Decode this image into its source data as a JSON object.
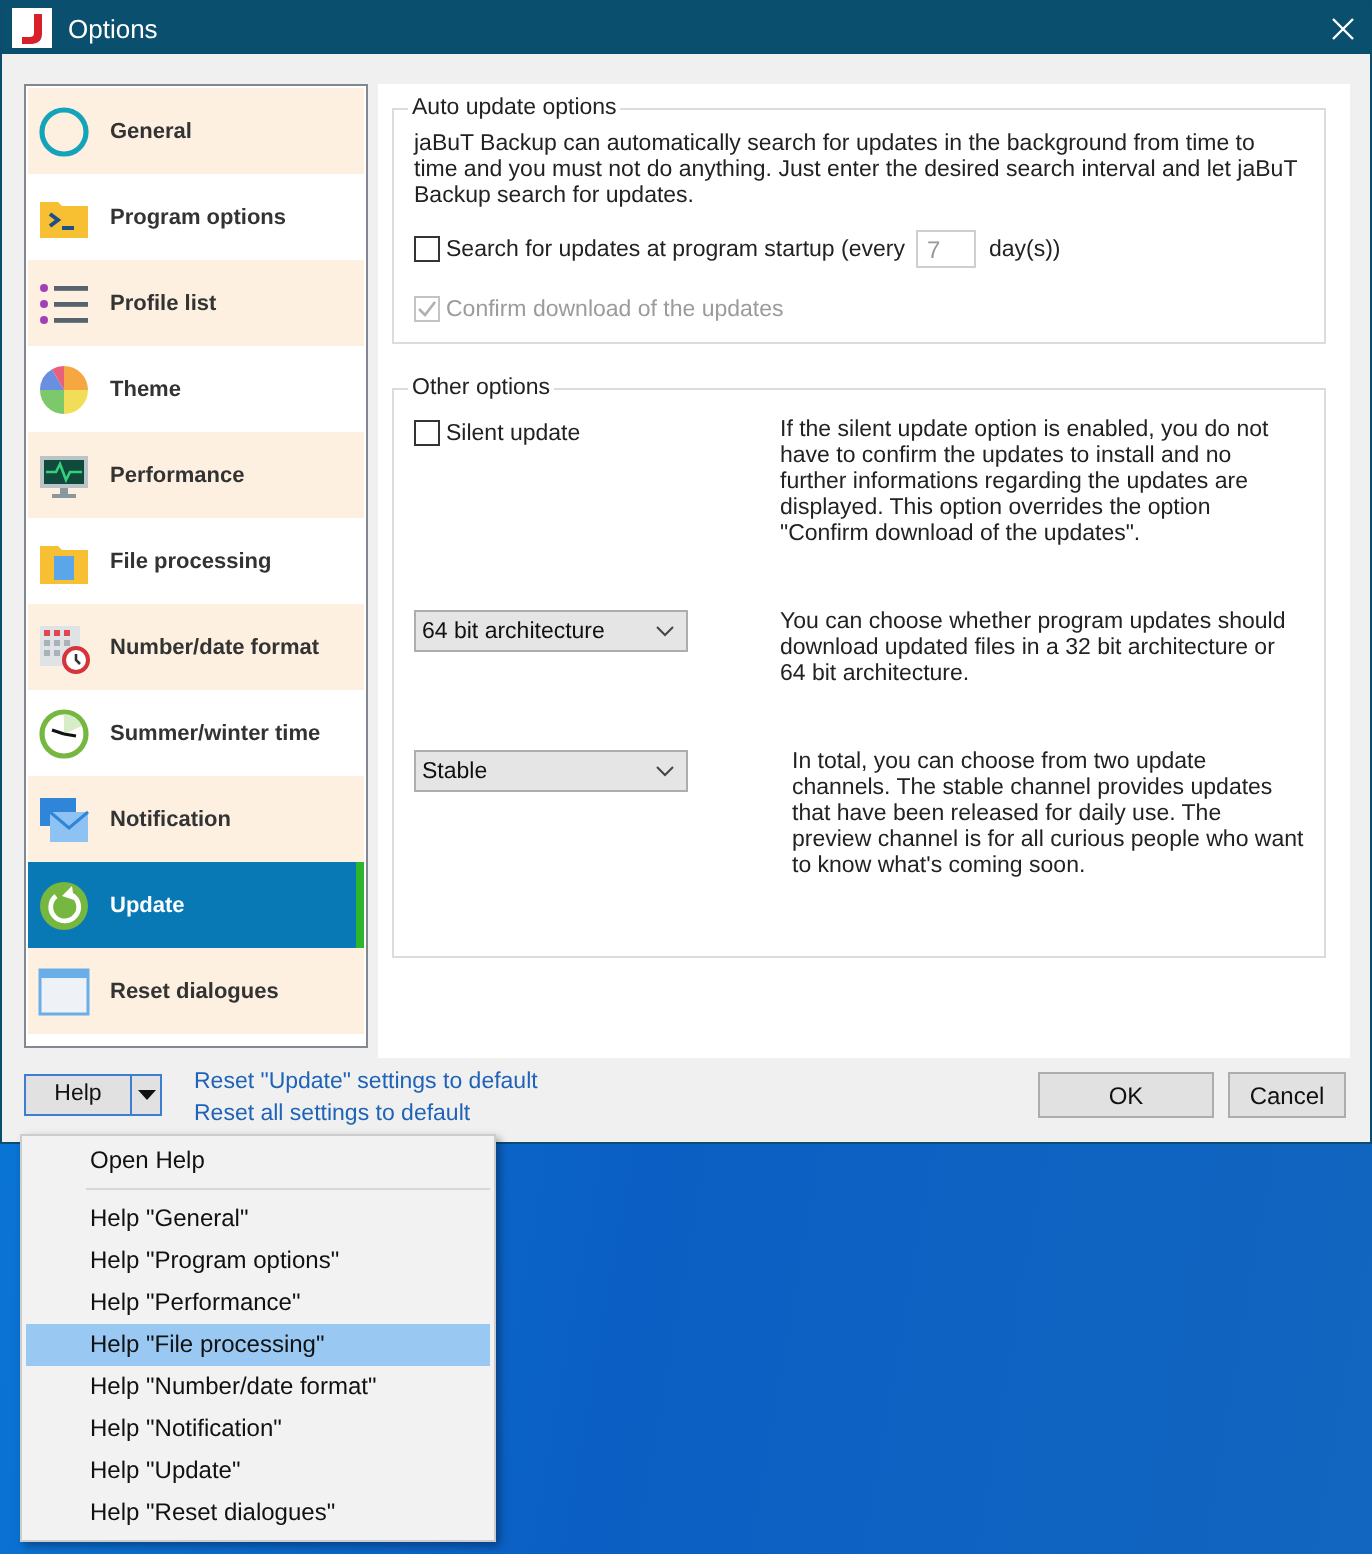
{
  "window": {
    "title": "Options"
  },
  "sidebar": {
    "items": [
      {
        "label": "General",
        "selected": false
      },
      {
        "label": "Program options",
        "selected": false
      },
      {
        "label": "Profile list",
        "selected": false
      },
      {
        "label": "Theme",
        "selected": false
      },
      {
        "label": "Performance",
        "selected": false
      },
      {
        "label": "File processing",
        "selected": false
      },
      {
        "label": "Number/date format",
        "selected": false
      },
      {
        "label": "Summer/winter time",
        "selected": false
      },
      {
        "label": "Notification",
        "selected": false
      },
      {
        "label": "Update",
        "selected": true
      },
      {
        "label": "Reset dialogues",
        "selected": false
      }
    ]
  },
  "auto_update": {
    "title": "Auto update options",
    "description": "jaBuT Backup can automatically search for updates in the background from time to time and you must not do anything. Just enter the desired search interval and let jaBuT Backup search for updates.",
    "startup_check": {
      "label": "Search for updates at program startup (every",
      "checked": false
    },
    "interval": {
      "value": "7",
      "disabled": true
    },
    "interval_unit": "day(s))",
    "confirm": {
      "label": "Confirm download of the updates",
      "checked": true,
      "disabled": true
    }
  },
  "other_options": {
    "title": "Other options",
    "silent": {
      "label": "Silent update",
      "checked": false
    },
    "silent_description": "If the silent update option is enabled, you do not have to confirm the updates to install and no further informations regarding the updates are displayed. This option overrides the option \"Confirm download of the updates\".",
    "architecture": {
      "value": "64 bit architecture"
    },
    "architecture_description": "You can choose whether program updates should download updated files in a 32 bit architecture or 64 bit architecture.",
    "channel": {
      "value": "Stable"
    },
    "channel_description": "In total, you can choose from two update channels. The stable channel provides updates that have been released for daily use. The preview channel is for all curious people who want to know what's coming soon."
  },
  "footer": {
    "help_button": "Help",
    "links": [
      "Reset \"Update\" settings to default",
      "Reset all settings to default"
    ],
    "ok": "OK",
    "cancel": "Cancel"
  },
  "help_menu": {
    "items": [
      {
        "kind": "item",
        "label": "Open Help",
        "selected": false
      },
      {
        "kind": "separator"
      },
      {
        "kind": "item",
        "label": "Help \"General\"",
        "selected": false
      },
      {
        "kind": "item",
        "label": "Help \"Program options\"",
        "selected": false
      },
      {
        "kind": "item",
        "label": "Help \"Performance\"",
        "selected": false
      },
      {
        "kind": "item",
        "label": "Help \"File processing\"",
        "selected": true
      },
      {
        "kind": "item",
        "label": "Help \"Number/date format\"",
        "selected": false
      },
      {
        "kind": "item",
        "label": "Help \"Notification\"",
        "selected": false
      },
      {
        "kind": "item",
        "label": "Help \"Update\"",
        "selected": false
      },
      {
        "kind": "item",
        "label": "Help \"Reset dialogues\"",
        "selected": false
      }
    ]
  }
}
